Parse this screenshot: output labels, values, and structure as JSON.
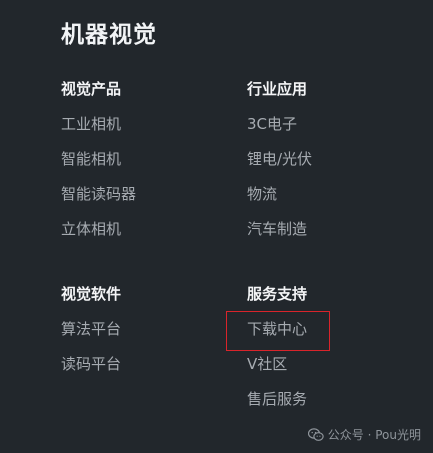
{
  "title": "机器视觉",
  "sections": {
    "vision_products": {
      "heading": "视觉产品",
      "items": [
        "工业相机",
        "智能相机",
        "智能读码器",
        "立体相机"
      ]
    },
    "industry_apps": {
      "heading": "行业应用",
      "items": [
        "3C电子",
        "锂电/光伏",
        "物流",
        "汽车制造"
      ]
    },
    "vision_software": {
      "heading": "视觉软件",
      "items": [
        "算法平台",
        "读码平台"
      ]
    },
    "service_support": {
      "heading": "服务支持",
      "items": [
        "下载中心",
        "V社区",
        "售后服务"
      ]
    }
  },
  "watermark": {
    "icon": "wechat-icon",
    "text": "公众号 · Pou光明"
  },
  "colors": {
    "background": "#22272c",
    "heading": "#f4f5f7",
    "link": "#a6abb1",
    "highlight": "#d9242b"
  }
}
